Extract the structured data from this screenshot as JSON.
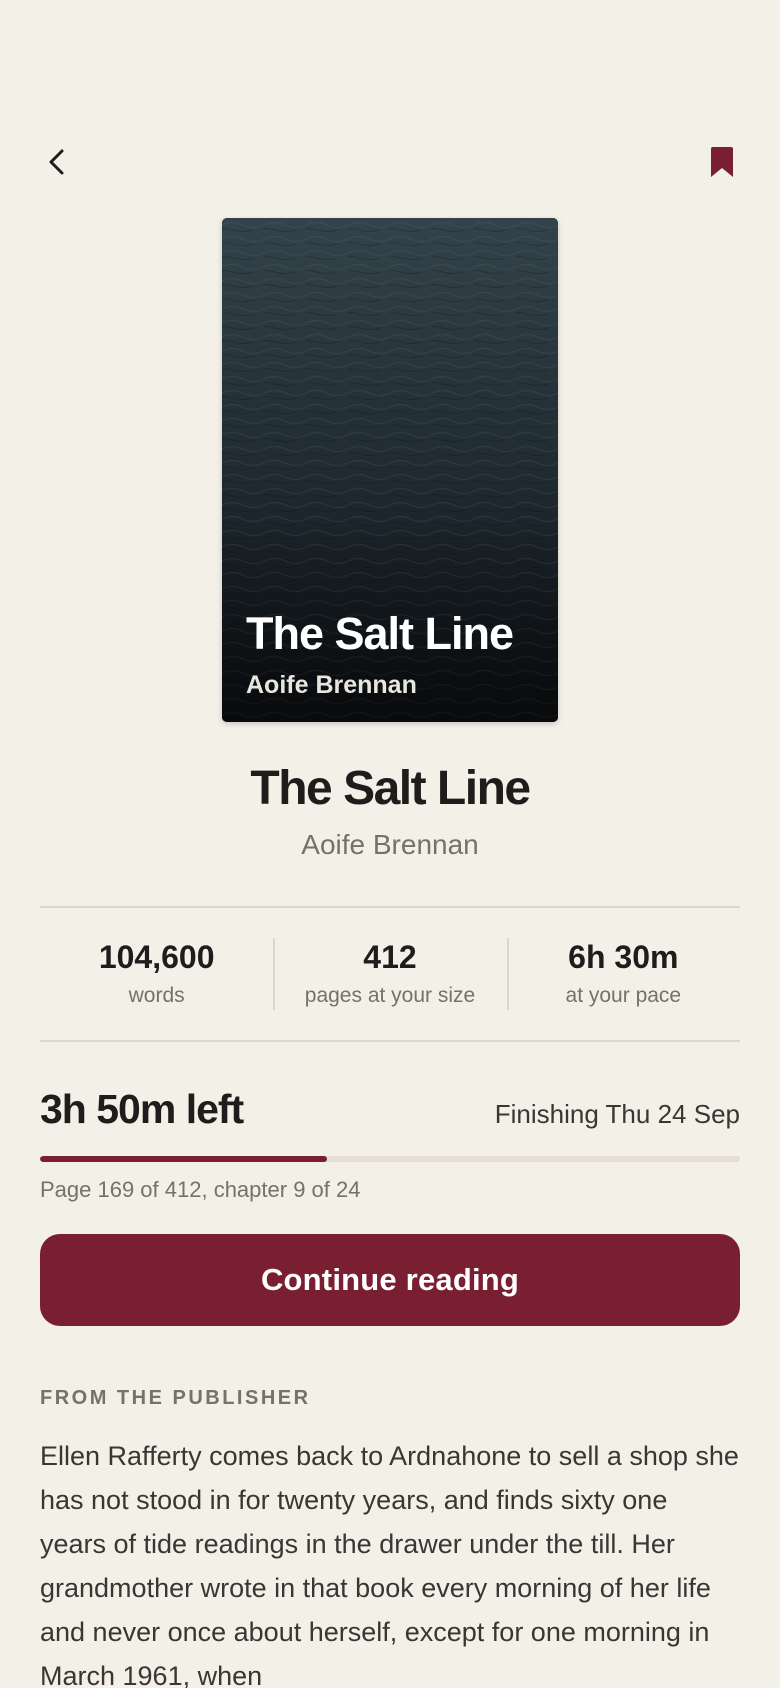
{
  "header": {
    "back_icon": "chevron-left-icon",
    "bookmark_icon": "bookmark-icon"
  },
  "cover": {
    "title": "The Salt Line",
    "author": "Aoife Brennan"
  },
  "book": {
    "title": "The Salt Line",
    "author": "Aoife Brennan"
  },
  "stats": [
    {
      "value": "104,600",
      "label": "words"
    },
    {
      "value": "412",
      "label": "pages at your size"
    },
    {
      "value": "6h 30m",
      "label": "at your pace"
    }
  ],
  "progress": {
    "time_left": "3h 50m left",
    "finishing": "Finishing Thu 24 Sep",
    "fraction": 0.41,
    "page_info": "Page 169 of 412, chapter 9 of 24"
  },
  "continue_button": {
    "label": "Continue reading"
  },
  "publisher": {
    "heading": "FROM THE PUBLISHER",
    "blurb": "Ellen Rafferty comes back to Ardnahone to sell a shop she has not stood in for twenty years, and finds sixty one years of tide readings in the drawer under the till. Her grandmother wrote in that book every morning of her life and never once about herself, except for one morning in March 1961, when"
  },
  "colors": {
    "background": "#f3f0e8",
    "accent": "#7a1f31",
    "text_primary": "#1f1d1b",
    "text_muted": "#76716a",
    "divider": "#dcd7cc"
  }
}
